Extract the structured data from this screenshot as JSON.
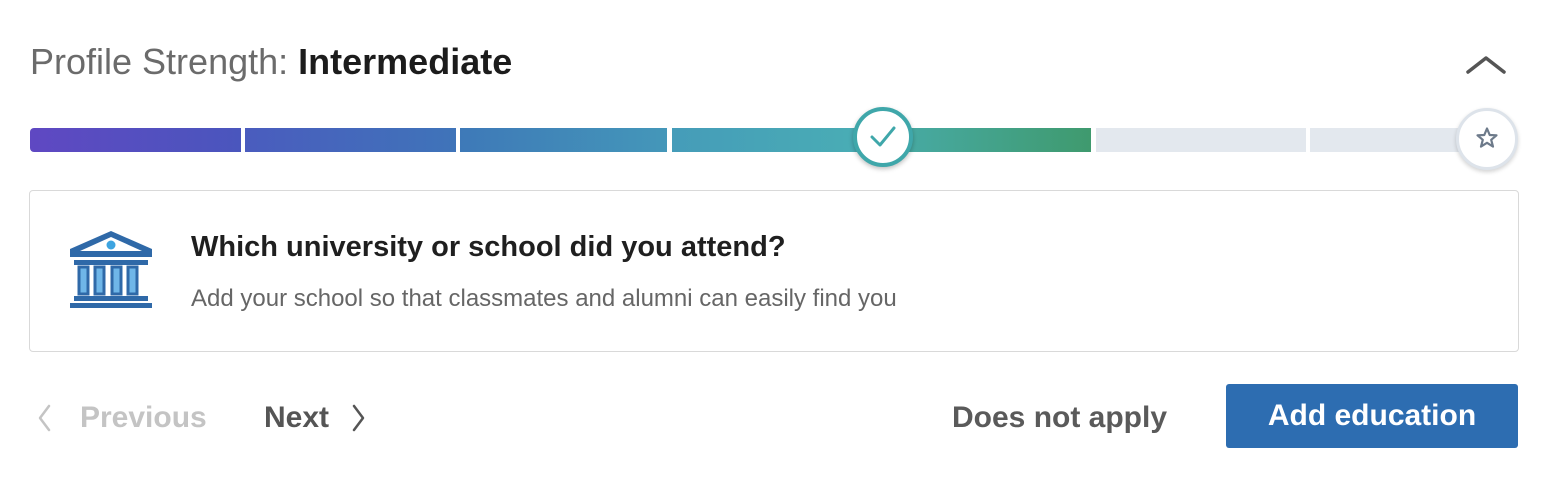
{
  "header": {
    "title_prefix": "Profile Strength:",
    "level": "Intermediate",
    "collapse_icon": "chevron-up-icon"
  },
  "progress": {
    "segments_total": 7,
    "segments_completed": 5,
    "current_marker_icon": "check-icon",
    "end_marker_icon": "star-icon",
    "colors": [
      "#5f48c2",
      "#4264b8",
      "#3f86b7",
      "#4aa8b8",
      "#3f9a6e",
      "#e3e8ee"
    ]
  },
  "prompt": {
    "icon": "school-building-icon",
    "title": "Which university or school did you attend?",
    "description": "Add your school so that classmates and alumni can easily find you"
  },
  "navigation": {
    "previous_label": "Previous",
    "next_label": "Next"
  },
  "actions": {
    "dismiss_label": "Does not apply",
    "primary_label": "Add education",
    "primary_color": "#2d6db1"
  }
}
